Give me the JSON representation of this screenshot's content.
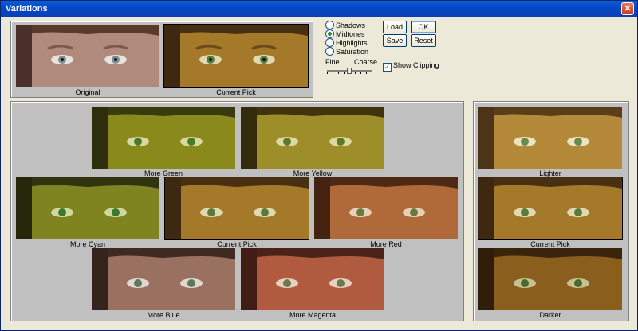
{
  "window": {
    "title": "Variations",
    "close_label": "✕"
  },
  "adjust_mode": {
    "options": [
      {
        "label": "Shadows",
        "selected": false
      },
      {
        "label": "Midtones",
        "selected": true
      },
      {
        "label": "Highlights",
        "selected": false
      },
      {
        "label": "Saturation",
        "selected": false
      }
    ]
  },
  "fine_coarse": {
    "fine_label": "Fine",
    "coarse_label": "Coarse",
    "value_fraction": 0.5
  },
  "buttons": {
    "load": "Load",
    "ok": "OK",
    "save": "Save",
    "reset": "Reset"
  },
  "show_clipping": {
    "label": "Show Clipping",
    "checked": true
  },
  "compare": {
    "original": "Original",
    "current_pick": "Current Pick"
  },
  "color_variations": {
    "more_green": "More Green",
    "more_yellow": "More Yellow",
    "more_cyan": "More Cyan",
    "current_pick": "Current Pick",
    "more_red": "More Red",
    "more_blue": "More Blue",
    "more_magenta": "More Magenta"
  },
  "brightness": {
    "lighter": "Lighter",
    "current_pick": "Current Pick",
    "darker": "Darker"
  },
  "colors": {
    "original": "#b08a7c",
    "current": "#a47a2a",
    "green": "#8a8a1c",
    "yellow": "#9e8e2a",
    "cyan": "#7f8420",
    "red": "#b06a3a",
    "blue": "#9a7060",
    "magenta": "#b05a40",
    "lighter": "#b48a3a",
    "darker": "#8a5e1c"
  }
}
